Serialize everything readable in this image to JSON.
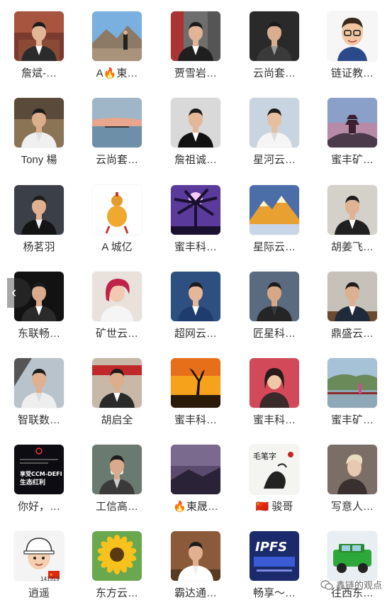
{
  "contacts": [
    {
      "name": "詹斌-…",
      "avatar": "man-portrait-office"
    },
    {
      "name": "A🔥東…",
      "avatar": "man-mountain-landscape"
    },
    {
      "name": "贾雪岩…",
      "avatar": "man-street-suit"
    },
    {
      "name": "云尚套…",
      "avatar": "man-dark-portrait"
    },
    {
      "name": "链证教…",
      "avatar": "cartoon-man-glasses"
    },
    {
      "name": "Tony 楊",
      "avatar": "man-white-shirt"
    },
    {
      "name": "云尚套…",
      "avatar": "sunset-seascape"
    },
    {
      "name": "詹祖诚…",
      "avatar": "man-black-suit"
    },
    {
      "name": "星河云…",
      "avatar": "man-casual-light"
    },
    {
      "name": "蜜丰矿…",
      "avatar": "pagoda-dusk"
    },
    {
      "name": "杨茗羽",
      "avatar": "man-arms-crossed"
    },
    {
      "name": "A 城亿",
      "avatar": "golden-gourd"
    },
    {
      "name": "蜜丰科…",
      "avatar": "palm-tree-purple"
    },
    {
      "name": "星际云…",
      "avatar": "golden-mountain"
    },
    {
      "name": "胡姜飞…",
      "avatar": "man-suit-studio"
    },
    {
      "name": "东联畅…",
      "avatar": "man-dark-suit-black"
    },
    {
      "name": "矿世云…",
      "avatar": "woman-red-hair"
    },
    {
      "name": "超网云…",
      "avatar": "man-blue-suit"
    },
    {
      "name": "匠星科…",
      "avatar": "man-dark-jacket"
    },
    {
      "name": "鼎盛云…",
      "avatar": "man-desk-office"
    },
    {
      "name": "智联数…",
      "avatar": "man-car-selfie"
    },
    {
      "name": "胡启全",
      "avatar": "man-red-banner"
    },
    {
      "name": "蜜丰科…",
      "avatar": "silhouette-sunset"
    },
    {
      "name": "蜜丰科…",
      "avatar": "woman-red-background"
    },
    {
      "name": "蜜丰矿…",
      "avatar": "lake-park-scene"
    },
    {
      "name": "你好，…",
      "avatar": "ccm-defi-poster"
    },
    {
      "name": "工信高…",
      "avatar": "man-face-mask"
    },
    {
      "name": "🔥東晟…",
      "avatar": "purple-sky-mountain"
    },
    {
      "name": "🇨🇳 骏哥",
      "avatar": "calligraphy-art"
    },
    {
      "name": "写意人…",
      "avatar": "blonde-man-profile"
    },
    {
      "name": "逍遥",
      "avatar": "cartoon-cap-flag"
    },
    {
      "name": "东方云…",
      "avatar": "sunflower"
    },
    {
      "name": "霸达通…",
      "avatar": "man-tea-table"
    },
    {
      "name": "畅享～…",
      "avatar": "ipfs-poster"
    },
    {
      "name": "往西东…",
      "avatar": "green-suv"
    }
  ],
  "poster": {
    "line1": "享受CCM-DEFI",
    "line2": "生态红利",
    "ipfs": "IPFS",
    "calligraphy": "毛笔字"
  },
  "tag_number": "141319",
  "watermark": "鑫链的观点",
  "arrow": "‹"
}
